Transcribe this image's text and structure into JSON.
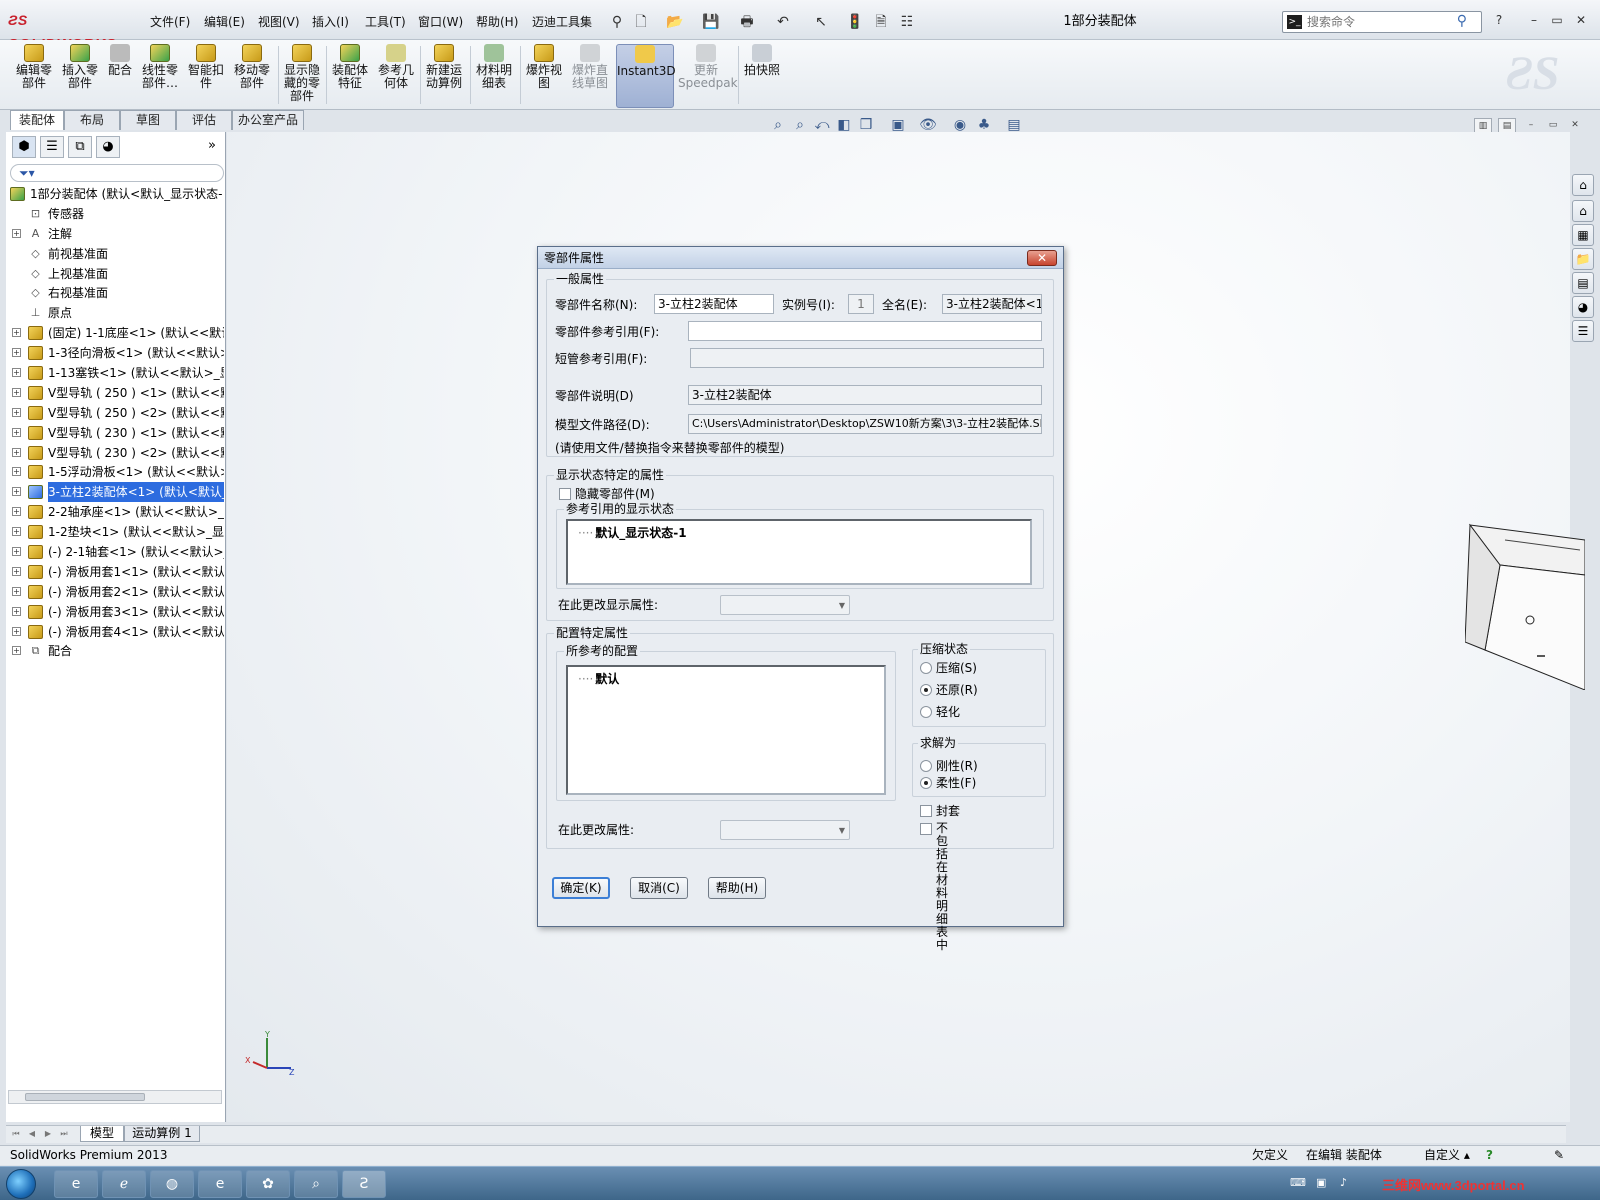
{
  "app": {
    "logo_text": "SOLIDWORKS",
    "document_title": "1部分装配体",
    "search_placeholder": "搜索命令"
  },
  "menu": [
    "文件(F)",
    "编辑(E)",
    "视图(V)",
    "插入(I)",
    "工具(T)",
    "窗口(W)",
    "帮助(H)",
    "迈迪工具集"
  ],
  "commands": [
    {
      "label": "编辑零\n部件",
      "icon": "edit-component-icon"
    },
    {
      "label": "插入零\n部件",
      "icon": "insert-component-icon"
    },
    {
      "label": "配合",
      "icon": "mate-icon"
    },
    {
      "label": "线性零\n部件…",
      "icon": "linear-pattern-icon"
    },
    {
      "label": "智能扣\n件",
      "icon": "smart-fastener-icon"
    },
    {
      "label": "移动零\n部件",
      "icon": "move-component-icon"
    },
    {
      "label": "显示隐\n藏的零\n部件",
      "icon": "show-hidden-icon"
    },
    {
      "label": "装配体\n特征",
      "icon": "assembly-feature-icon"
    },
    {
      "label": "参考几\n何体",
      "icon": "reference-geometry-icon"
    },
    {
      "label": "新建运\n动算例",
      "icon": "new-motion-study-icon"
    },
    {
      "label": "材料明\n细表",
      "icon": "bom-icon"
    },
    {
      "label": "爆炸视\n图",
      "icon": "exploded-view-icon"
    },
    {
      "label": "爆炸直\n线草图",
      "icon": "explode-line-sketch-icon"
    },
    {
      "label": "Instant3D",
      "icon": "instant3d-icon"
    },
    {
      "label": "更新\nSpeedpak",
      "icon": "speedpak-icon"
    },
    {
      "label": "拍快照",
      "icon": "snapshot-icon"
    }
  ],
  "tabs": [
    "装配体",
    "布局",
    "草图",
    "评估",
    "办公室产品"
  ],
  "tree": {
    "root": "1部分装配体 (默认<默认_显示状态-",
    "items": [
      {
        "label": "传感器",
        "icon": "sensor-icon",
        "expand": false
      },
      {
        "label": "注解",
        "icon": "annotation-icon",
        "expand": true
      },
      {
        "label": "前视基准面",
        "icon": "plane-icon",
        "expand": false
      },
      {
        "label": "上视基准面",
        "icon": "plane-icon",
        "expand": false
      },
      {
        "label": "右视基准面",
        "icon": "plane-icon",
        "expand": false
      },
      {
        "label": "原点",
        "icon": "origin-icon",
        "expand": false
      },
      {
        "label": "(固定) 1-1底座<1> (默认<<默认",
        "icon": "part-icon",
        "expand": true
      },
      {
        "label": "1-3径向滑板<1> (默认<<默认>",
        "icon": "part-icon",
        "expand": true
      },
      {
        "label": "1-13塞铁<1> (默认<<默认>_显",
        "icon": "part-icon",
        "expand": true
      },
      {
        "label": "V型导轨 ( 250 ) <1> (默认<<默",
        "icon": "part-icon",
        "expand": true
      },
      {
        "label": "V型导轨 ( 250 ) <2> (默认<<默",
        "icon": "part-icon",
        "expand": true
      },
      {
        "label": "V型导轨 ( 230 ) <1> (默认<<默",
        "icon": "part-icon",
        "expand": true
      },
      {
        "label": "V型导轨 ( 230 ) <2> (默认<<默",
        "icon": "part-icon",
        "expand": true
      },
      {
        "label": "1-5浮动滑板<1> (默认<<默认>",
        "icon": "part-icon",
        "expand": true
      },
      {
        "label": "3-立柱2装配体<1> (默认<默认_",
        "icon": "assembly-icon",
        "expand": true,
        "selected": true
      },
      {
        "label": "2-2轴承座<1> (默认<<默认>_显",
        "icon": "part-icon",
        "expand": true
      },
      {
        "label": "1-2垫块<1> (默认<<默认>_显示",
        "icon": "part-icon",
        "expand": true
      },
      {
        "label": "(-) 2-1轴套<1> (默认<<默认>_",
        "icon": "part-icon",
        "expand": true
      },
      {
        "label": "(-) 滑板用套1<1> (默认<<默认:",
        "icon": "part-icon",
        "expand": true
      },
      {
        "label": "(-) 滑板用套2<1> (默认<<默认:",
        "icon": "part-icon",
        "expand": true
      },
      {
        "label": "(-) 滑板用套3<1> (默认<<默认:",
        "icon": "part-icon",
        "expand": true
      },
      {
        "label": "(-) 滑板用套4<1> (默认<<默认:",
        "icon": "part-icon",
        "expand": true
      },
      {
        "label": "配合",
        "icon": "mates-folder-icon",
        "expand": true
      }
    ]
  },
  "dialog": {
    "title": "零部件属性",
    "general_group": "一般属性",
    "name_label": "零部件名称(N):",
    "name_value": "3-立柱2装配体",
    "instance_label": "实例号(I):",
    "instance_value": "1",
    "fullname_label": "全名(E):",
    "fullname_value": "3-立柱2装配体<1>",
    "ref_label": "零部件参考引用(F):",
    "ref_value": "",
    "short_ref_label": "短管参考引用(F):",
    "desc_label": "零部件说明(D)",
    "desc_value": "3-立柱2装配体",
    "path_label": "模型文件路径(D):",
    "path_value": "C:\\Users\\Administrator\\Desktop\\ZSW10新方案\\3\\3-立柱2装配体.SLDASM",
    "path_note": "(请使用文件/替换指令来替换零部件的模型)",
    "display_group": "显示状态特定的属性",
    "hide_label": "隐藏零部件(M)",
    "ref_display_label": "参考引用的显示状态",
    "display_state_item": "默认_显示状态-1",
    "change_display_label": "在此更改显示属性:",
    "config_group": "配置特定属性",
    "ref_config_label": "所参考的配置",
    "config_item": "默认",
    "change_config_label": "在此更改属性:",
    "suppress_group": "压缩状态",
    "suppress_options": [
      "压缩(S)",
      "还原(R)",
      "轻化"
    ],
    "suppress_selected": 1,
    "solve_group": "求解为",
    "solve_options": [
      "刚性(R)",
      "柔性(F)"
    ],
    "solve_selected": 1,
    "envelope_label": "封套",
    "exclude_bom_label": "不包括在\n材料明细表中",
    "ok_label": "确定(K)",
    "cancel_label": "取消(C)",
    "help_label": "帮助(H)"
  },
  "bottom_tabs": [
    "模型",
    "运动算例 1"
  ],
  "status": {
    "product": "SolidWorks Premium 2013",
    "underdefined": "欠定义",
    "editing": "在编辑 装配体",
    "custom": "自定义"
  },
  "taskbar": {
    "watermark": "三维网www.3dportal.cn"
  },
  "colors": {
    "selection": "#2d6cdf",
    "logo": "#c8202c",
    "taskbar": "#3e6689"
  }
}
